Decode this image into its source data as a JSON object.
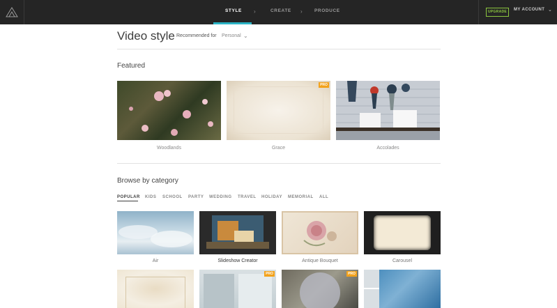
{
  "nav": {
    "steps": [
      {
        "label": "STYLE",
        "active": true
      },
      {
        "label": "CREATE",
        "active": false
      },
      {
        "label": "PRODUCE",
        "active": false
      }
    ],
    "upgrade_label": "UPGRADE",
    "account_label": "MY ACCOUNT",
    "colors": {
      "bar": "#252525",
      "active_underline": "#2bb3c5",
      "upgrade": "#8cc63f"
    }
  },
  "header": {
    "title": "Video style",
    "recommended_label": "Recommended for",
    "recommended_value": "Personal"
  },
  "featured": {
    "title": "Featured",
    "items": [
      {
        "name": "Woodlands",
        "pro": false
      },
      {
        "name": "Grace",
        "pro": true,
        "badge": "PRO"
      },
      {
        "name": "Accolades",
        "pro": false
      }
    ]
  },
  "browse": {
    "title": "Browse by category",
    "categories": [
      "POPULAR",
      "KIDS",
      "SCHOOL",
      "PARTY",
      "WEDDING",
      "TRAVEL",
      "HOLIDAY",
      "MEMORIAL",
      "ALL"
    ],
    "active_category": "POPULAR",
    "tiles": [
      {
        "name": "Air",
        "pro": false
      },
      {
        "name": "Slideshow Creator",
        "pro": false
      },
      {
        "name": "Antique Bouquet",
        "pro": false
      },
      {
        "name": "Carousel",
        "pro": false
      }
    ],
    "tiles_row2": [
      {
        "pro": false
      },
      {
        "pro": true,
        "badge": "PRO"
      },
      {
        "pro": true,
        "badge": "PRO"
      },
      {
        "pro": false
      }
    ]
  },
  "colors": {
    "pro_badge": "#f3a21b"
  }
}
